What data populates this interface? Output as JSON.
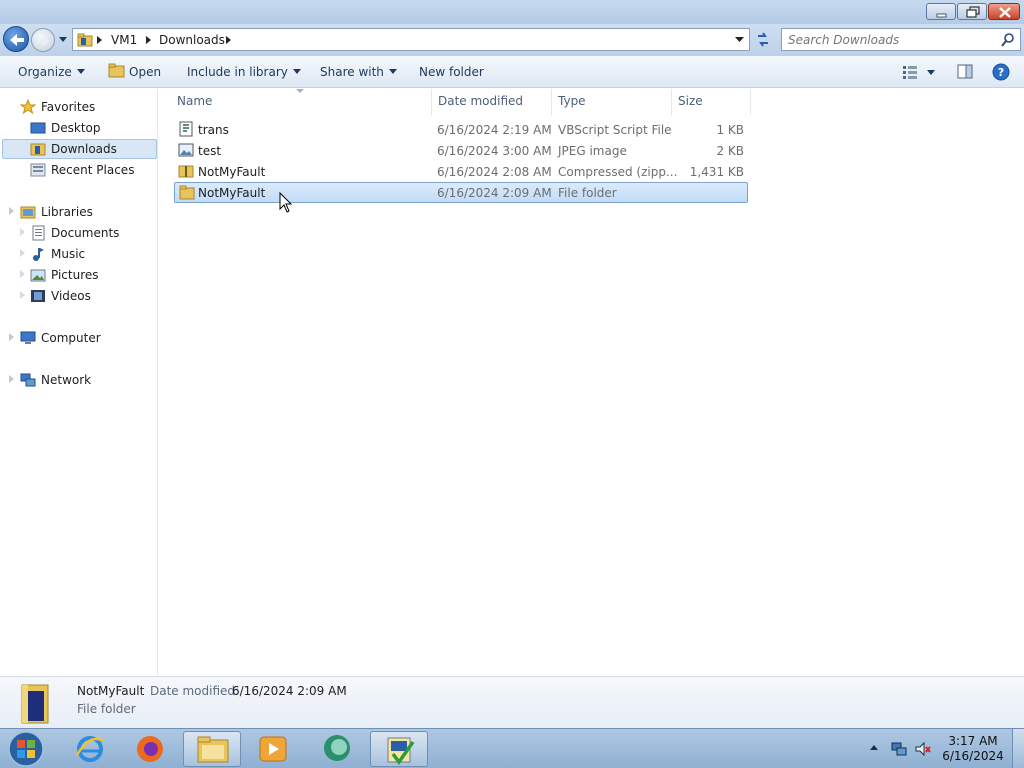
{
  "address": {
    "segments": [
      "VM1",
      "Downloads"
    ]
  },
  "search": {
    "placeholder": "Search Downloads"
  },
  "toolbar": {
    "organize": "Organize",
    "open": "Open",
    "include_in_library": "Include in library",
    "share_with": "Share with",
    "new_folder": "New folder"
  },
  "nav": {
    "favorites": "Favorites",
    "desktop": "Desktop",
    "downloads": "Downloads",
    "recent_places": "Recent Places",
    "libraries": "Libraries",
    "documents": "Documents",
    "music": "Music",
    "pictures": "Pictures",
    "videos": "Videos",
    "computer": "Computer",
    "network": "Network"
  },
  "columns": {
    "name": "Name",
    "date_modified": "Date modified",
    "type": "Type",
    "size": "Size"
  },
  "files": [
    {
      "name": "trans",
      "date": "6/16/2024 2:19 AM",
      "type": "VBScript Script File",
      "size": "1 KB",
      "icon": "vbscript-file-icon"
    },
    {
      "name": "test",
      "date": "6/16/2024 3:00 AM",
      "type": "JPEG image",
      "size": "2 KB",
      "icon": "image-file-icon"
    },
    {
      "name": "NotMyFault",
      "date": "6/16/2024 2:08 AM",
      "type": "Compressed (zipp...",
      "size": "1,431 KB",
      "icon": "zip-folder-icon"
    },
    {
      "name": "NotMyFault",
      "date": "6/16/2024 2:09 AM",
      "type": "File folder",
      "size": "",
      "icon": "folder-icon",
      "selected": true
    }
  ],
  "details": {
    "name": "NotMyFault",
    "date_label": "Date modified:",
    "date_value": "6/16/2024 2:09 AM",
    "type": "File folder"
  },
  "clock": {
    "time": "3:17 AM",
    "date": "6/16/2024"
  },
  "colors": {
    "selection": "#c1dcf8",
    "taskbar": "#8fb0d3",
    "title": "#b4cbe6"
  }
}
